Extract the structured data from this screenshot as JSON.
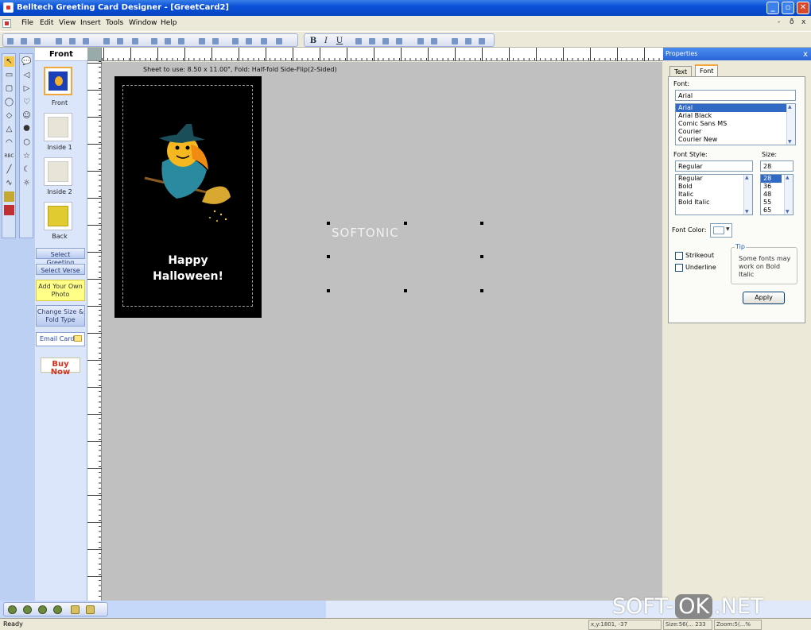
{
  "window": {
    "title": "Belltech Greeting Card Designer - [GreetCard2]",
    "min_glyph": "_",
    "max_glyph": "▫",
    "close_glyph": "✕"
  },
  "menu": {
    "items": [
      "File",
      "Edit",
      "View",
      "Insert",
      "Tools",
      "Window",
      "Help"
    ],
    "mdi_min": "-",
    "mdi_restore": "ð",
    "mdi_close": "x"
  },
  "toolbar": {
    "bold": "B",
    "italic": "I",
    "underline": "U"
  },
  "pages": {
    "header": "Front",
    "items": [
      {
        "label": "Front"
      },
      {
        "label": "Inside 1"
      },
      {
        "label": "Inside 2"
      },
      {
        "label": "Back"
      }
    ],
    "buttons": {
      "select_greeting": "Select Greeting",
      "select_verse": "Select Verse",
      "add_photo": "Add Your Own Photo",
      "change_size": "Change Size & Fold Type",
      "email_card": "Email Card",
      "buy_now": "Buy Now"
    }
  },
  "canvas": {
    "sheet_info": "Sheet to use: 8.50 x 11.00\", Fold: Half-fold Side-Flip(2-Sided)",
    "card_line1": "Happy",
    "card_line2": "Halloween!",
    "selected_text": "SOFTONIC"
  },
  "properties": {
    "title": "Properties",
    "close_glyph": "x",
    "tabs": [
      "Text",
      "Font"
    ],
    "active_tab": "Font",
    "font_label": "Font:",
    "font_value": "Arial",
    "font_list": [
      "Arial",
      "Arial Black",
      "Comic Sans MS",
      "Courier",
      "Courier New"
    ],
    "font_style_label": "Font Style:",
    "font_style_value": "Regular",
    "style_list": [
      "Regular",
      "Bold",
      "Italic",
      "Bold Italic"
    ],
    "size_label": "Size:",
    "size_value": "28",
    "size_list": [
      "28",
      "36",
      "48",
      "55",
      "65"
    ],
    "font_color_label": "Font Color:",
    "font_color": "#ffffff",
    "strikeout_label": "Strikeout",
    "underline_label": "Underline",
    "tip_label": "Tip",
    "tip_text": "Some fonts may work on Bold Italic",
    "apply_label": "Apply"
  },
  "status": {
    "text": "Ready",
    "coords": "x,y:1801, -37",
    "size": "Size:56(... 233",
    "zoom": "Zoom:5(...%"
  },
  "watermark": {
    "left": "SOFT-",
    "mid": "OK",
    "right": ".NET"
  }
}
